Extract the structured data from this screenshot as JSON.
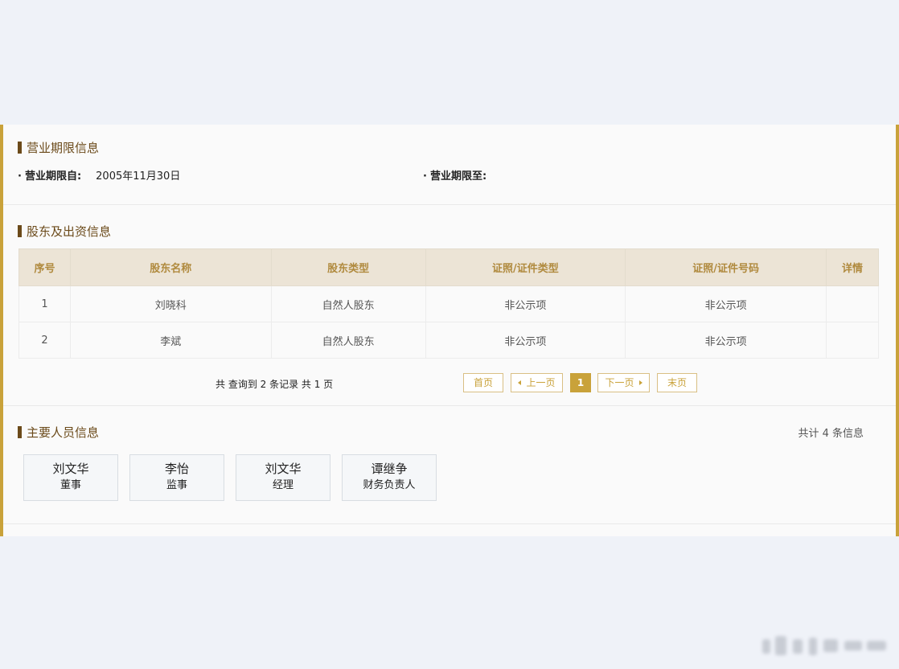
{
  "business_term": {
    "title": "营业期限信息",
    "from_label": "营业期限自:",
    "from_value": "2005年11月30日",
    "to_label": "营业期限至:",
    "to_value": ""
  },
  "shareholders": {
    "title": "股东及出资信息",
    "columns": [
      "序号",
      "股东名称",
      "股东类型",
      "证照/证件类型",
      "证照/证件号码",
      "详情"
    ],
    "rows": [
      [
        "1",
        "刘晓科",
        "自然人股东",
        "非公示项",
        "非公示项",
        ""
      ],
      [
        "2",
        "李斌",
        "自然人股东",
        "非公示项",
        "非公示项",
        ""
      ]
    ],
    "pager": {
      "info": "共 查询到 2 条记录 共 1 页",
      "first": "首页",
      "prev": "上一页",
      "current": "1",
      "next": "下一页",
      "last": "末页"
    }
  },
  "key_personnel": {
    "title": "主要人员信息",
    "count_note": "共计 4 条信息",
    "people": [
      {
        "name": "刘文华",
        "role": "董事"
      },
      {
        "name": "李怡",
        "role": "监事"
      },
      {
        "name": "刘文华",
        "role": "经理"
      },
      {
        "name": "谭继争",
        "role": "财务负责人"
      }
    ]
  },
  "colors": {
    "accent": "#c9a23a",
    "title": "#6b4a1a",
    "table_header_bg": "#ece4d6",
    "page_bg": "#eff2f8"
  }
}
